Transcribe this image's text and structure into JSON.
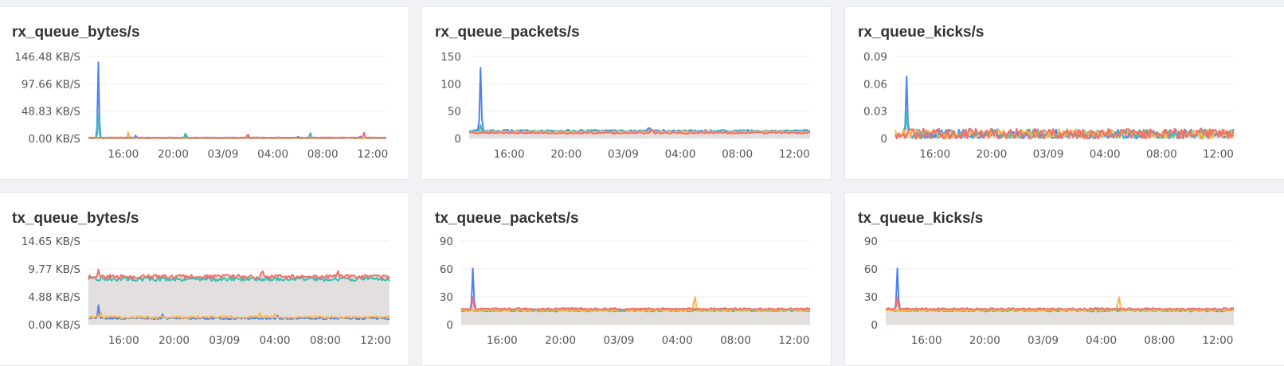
{
  "colors": {
    "blue": "#4e83f5",
    "teal": "#36c1b2",
    "orange": "#f9b54b",
    "red": "#f0716d",
    "fill": "#e0dcda",
    "grid": "#eeeeee"
  },
  "x_tick_labels": [
    "16:00",
    "20:00",
    "03/09",
    "04:00",
    "08:00",
    "12:00"
  ],
  "chart_data": [
    {
      "id": "rx_bytes",
      "type": "line",
      "title": "rx_queue_bytes/s",
      "y_tick_labels": [
        "0.00 KB/S",
        "48.83 KB/S",
        "97.66 KB/S",
        "146.48 KB/S"
      ],
      "ylim": [
        0,
        146.48
      ],
      "unit": "KB/S",
      "x_range": [
        13.2,
        37.1
      ],
      "x_ticks": [
        16,
        20,
        24,
        28,
        32,
        36
      ],
      "series": [
        {
          "color": "blue",
          "baseline": 0.5,
          "noise": 0.3,
          "spikes": [
            [
              14.0,
              140
            ],
            [
              17.0,
              6
            ],
            [
              21.0,
              6
            ],
            [
              26.0,
              5
            ],
            [
              30.0,
              4
            ],
            [
              35.0,
              4
            ]
          ]
        },
        {
          "color": "teal",
          "baseline": 0.6,
          "noise": 0.3,
          "spikes": [
            [
              14.0,
              45
            ],
            [
              21.0,
              12
            ],
            [
              31.0,
              12
            ]
          ]
        },
        {
          "color": "orange",
          "baseline": 0.8,
          "noise": 0.3,
          "spikes": [
            [
              16.4,
              12
            ],
            [
              26.0,
              8
            ]
          ]
        },
        {
          "color": "red",
          "baseline": 1.5,
          "noise": 0.4,
          "spikes": [
            [
              26.0,
              10
            ],
            [
              35.3,
              11
            ]
          ]
        }
      ]
    },
    {
      "id": "rx_packets",
      "type": "line",
      "title": "rx_queue_packets/s",
      "y_tick_labels": [
        "0",
        "50",
        "100",
        "150"
      ],
      "ylim": [
        0,
        150
      ],
      "x_range": [
        13.2,
        37.1
      ],
      "x_ticks": [
        16,
        20,
        24,
        28,
        32,
        36
      ],
      "series": [
        {
          "color": "blue",
          "baseline": 14,
          "noise": 2,
          "spikes": [
            [
              14.0,
              133
            ],
            [
              25.8,
              22
            ]
          ]
        },
        {
          "color": "teal",
          "baseline": 13,
          "noise": 1.5,
          "spikes": [
            [
              14.0,
              25
            ],
            [
              21.5,
              15
            ],
            [
              31.0,
              17
            ]
          ]
        },
        {
          "color": "orange",
          "baseline": 12,
          "noise": 1.5,
          "spikes": [
            [
              16.5,
              14
            ]
          ]
        },
        {
          "color": "red",
          "baseline": 10,
          "noise": 1.5,
          "spikes": [
            [
              26.0,
              21
            ]
          ]
        }
      ]
    },
    {
      "id": "rx_kicks",
      "type": "line",
      "title": "rx_queue_kicks/s",
      "y_tick_labels": [
        "0",
        "0.03",
        "0.06",
        "0.09"
      ],
      "ylim": [
        0,
        0.09
      ],
      "x_range": [
        13.2,
        37.1
      ],
      "x_ticks": [
        16,
        20,
        24,
        28,
        32,
        36
      ],
      "series": [
        {
          "color": "blue",
          "baseline": 0.005,
          "noise": 0.005,
          "spikes": [
            [
              14.0,
              0.07
            ]
          ]
        },
        {
          "color": "teal",
          "baseline": 0.005,
          "noise": 0.005,
          "spikes": [
            [
              14.0,
              0.03
            ]
          ]
        },
        {
          "color": "orange",
          "baseline": 0.005,
          "noise": 0.005,
          "spikes": []
        },
        {
          "color": "red",
          "baseline": 0.005,
          "noise": 0.006,
          "spikes": []
        }
      ]
    },
    {
      "id": "tx_bytes",
      "type": "line",
      "title": "tx_queue_bytes/s",
      "y_tick_labels": [
        "0.00 KB/S",
        "4.88 KB/S",
        "9.77 KB/S",
        "14.65 KB/S"
      ],
      "ylim": [
        0,
        14.65
      ],
      "unit": "KB/S",
      "x_range": [
        13.2,
        37.1
      ],
      "x_ticks": [
        16,
        20,
        24,
        28,
        32,
        36
      ],
      "series": [
        {
          "color": "teal",
          "baseline": 8.0,
          "noise": 0.35,
          "spikes": [
            [
              15.3,
              6.8
            ],
            [
              16.7,
              7.6
            ]
          ]
        },
        {
          "color": "red",
          "baseline": 8.4,
          "noise": 0.35,
          "spikes": [
            [
              14.0,
              9.7
            ],
            [
              27.0,
              9.9
            ],
            [
              33.0,
              9.6
            ]
          ]
        },
        {
          "color": "blue",
          "baseline": 1.1,
          "noise": 0.15,
          "spikes": [
            [
              14.0,
              3.5
            ],
            [
              19.1,
              2.0
            ],
            [
              28.2,
              1.8
            ]
          ]
        },
        {
          "color": "orange",
          "baseline": 1.3,
          "noise": 0.2,
          "spikes": [
            [
              14.2,
              2.1
            ],
            [
              26.8,
              2.4
            ],
            [
              28.0,
              2.1
            ]
          ]
        }
      ]
    },
    {
      "id": "tx_packets",
      "type": "line",
      "title": "tx_queue_packets/s",
      "y_tick_labels": [
        "0",
        "30",
        "60",
        "90"
      ],
      "ylim": [
        0,
        90
      ],
      "x_range": [
        13.2,
        37.1
      ],
      "x_ticks": [
        16,
        20,
        24,
        28,
        32,
        36
      ],
      "series": [
        {
          "color": "blue",
          "baseline": 16,
          "noise": 0.8,
          "spikes": [
            [
              14.0,
              62
            ]
          ]
        },
        {
          "color": "teal",
          "baseline": 15,
          "noise": 0.8,
          "spikes": []
        },
        {
          "color": "orange",
          "baseline": 15.5,
          "noise": 0.8,
          "spikes": [
            [
              29.2,
              35
            ]
          ]
        },
        {
          "color": "red",
          "baseline": 17,
          "noise": 0.9,
          "spikes": [
            [
              14.0,
              30
            ]
          ]
        }
      ]
    },
    {
      "id": "tx_kicks",
      "type": "line",
      "title": "tx_queue_kicks/s",
      "y_tick_labels": [
        "0",
        "30",
        "60",
        "90"
      ],
      "ylim": [
        0,
        90
      ],
      "x_range": [
        13.2,
        37.1
      ],
      "x_ticks": [
        16,
        20,
        24,
        28,
        32,
        36
      ],
      "series": [
        {
          "color": "blue",
          "baseline": 16,
          "noise": 0.8,
          "spikes": [
            [
              14.0,
              62
            ]
          ]
        },
        {
          "color": "teal",
          "baseline": 15,
          "noise": 0.8,
          "spikes": []
        },
        {
          "color": "orange",
          "baseline": 15.5,
          "noise": 0.8,
          "spikes": [
            [
              29.2,
              35
            ]
          ]
        },
        {
          "color": "red",
          "baseline": 17,
          "noise": 0.9,
          "spikes": [
            [
              14.0,
              30
            ]
          ]
        }
      ]
    }
  ]
}
